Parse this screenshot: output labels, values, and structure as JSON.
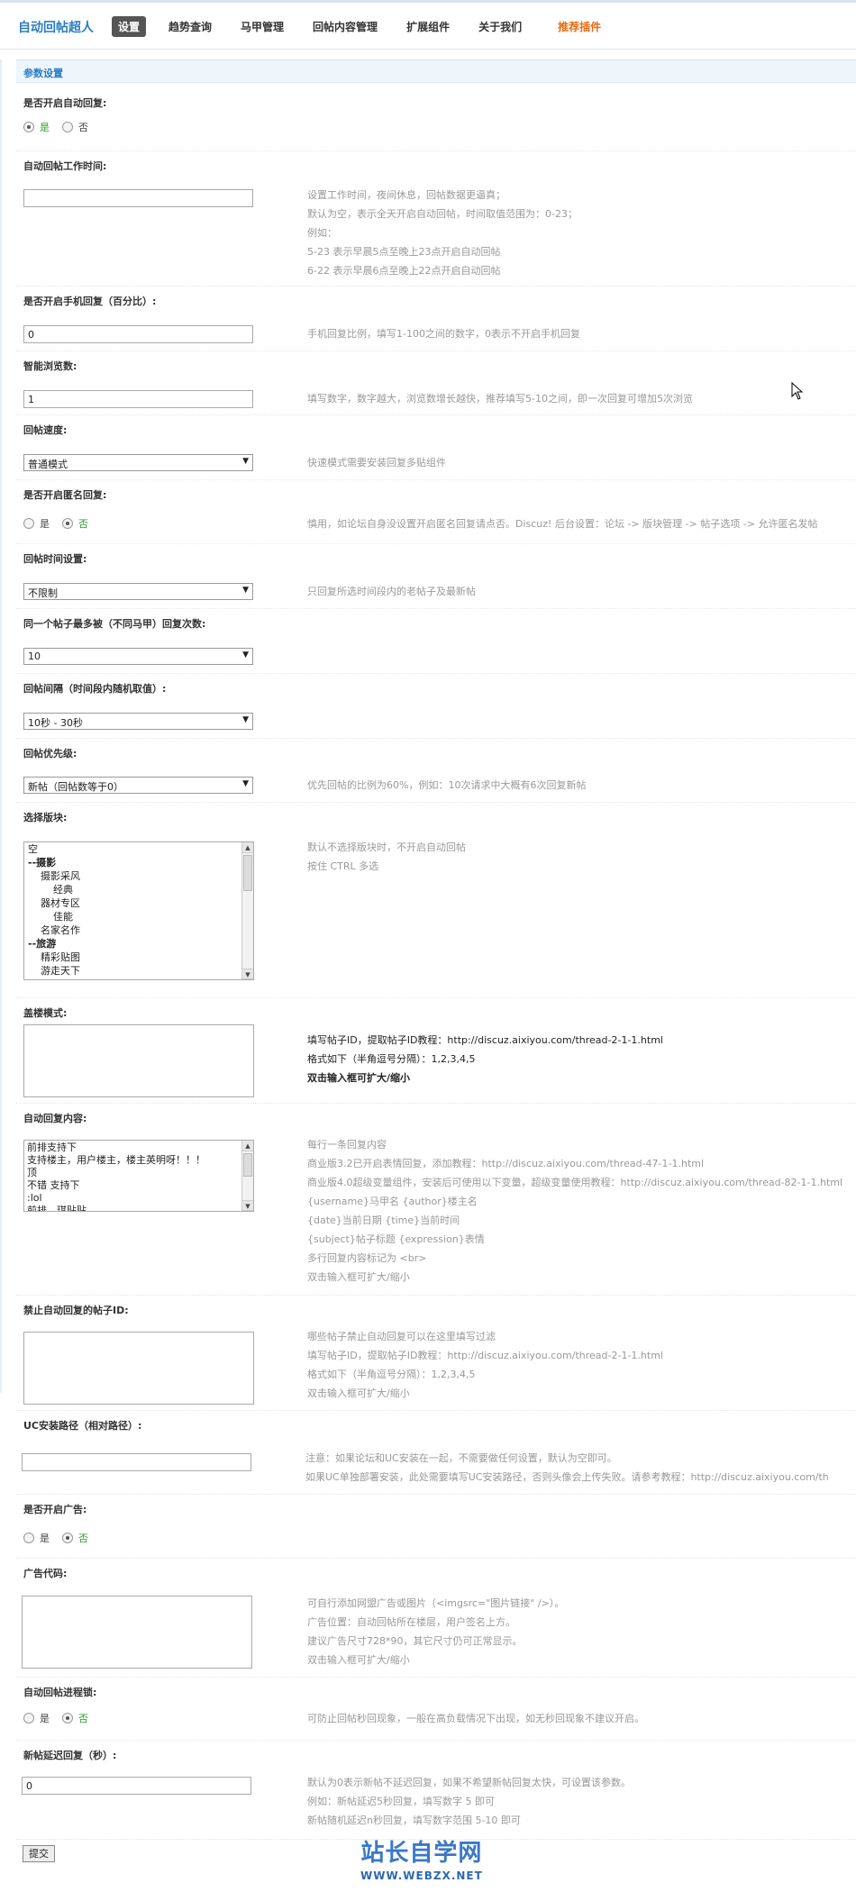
{
  "header": {
    "brand": "自动回帖超人",
    "nav": [
      "设置",
      "趋势查询",
      "马甲管理",
      "回帖内容管理",
      "扩展组件",
      "关于我们"
    ],
    "promo": "推荐插件"
  },
  "section_title": "参数设置",
  "rows": {
    "auto_reply": {
      "label": "是否开启自动回复:",
      "yes": "是",
      "no": "否",
      "selected": "是"
    },
    "work_time": {
      "label": "自动回帖工作时间:",
      "value": "",
      "help": [
        "设置工作时间，夜间休息，回帖数据更逼真；",
        "默认为空，表示全天开启自动回帖，时间取值范围为：0-23；",
        "例如：",
        "5-23 表示早晨5点至晚上23点开启自动回帖",
        "6-22 表示早晨6点至晚上22点开启自动回帖"
      ]
    },
    "mobile_reply": {
      "label": "是否开启手机回复（百分比）:",
      "value": "0",
      "help": "手机回复比例，填写1-100之间的数字，0表示不开启手机回复"
    },
    "browse_count": {
      "label": "智能浏览数:",
      "value": "1",
      "help": "填写数字，数字越大，浏览数增长越快，推荐填写5-10之间，即一次回复可增加5次浏览"
    },
    "reply_speed": {
      "label": "回帖速度:",
      "value": "普通模式",
      "help": "快速模式需要安装回复多贴组件"
    },
    "anonymous": {
      "label": "是否开启匿名回复:",
      "yes": "是",
      "no": "否",
      "selected": "否",
      "help": "慎用，如论坛自身没设置开启匿名回复请点否。Discuz! 后台设置：论坛 -> 版块管理 -> 帖子选项 -> 允许匿名发帖"
    },
    "reply_time": {
      "label": "回帖时间设置:",
      "value": "不限制",
      "help": "只回复所选时间段内的老帖子及最新帖"
    },
    "max_replies": {
      "label": "同一个帖子最多被（不同马甲）回复次数:",
      "value": "10"
    },
    "interval": {
      "label": "回帖间隔（时间段内随机取值）:",
      "value": "10秒 - 30秒"
    },
    "priority": {
      "label": "回帖优先级:",
      "value": "新帖（回帖数等于0）",
      "help": "优先回帖的比例为60%，例如：10次请求中大概有6次回复新帖"
    },
    "forums": {
      "label": "选择版块:",
      "options": [
        {
          "text": "空",
          "group": false
        },
        {
          "text": "--摄影",
          "group": true
        },
        {
          "text": "    摄影采风",
          "group": false
        },
        {
          "text": "        经典",
          "group": false
        },
        {
          "text": "    器材专区",
          "group": false
        },
        {
          "text": "        佳能",
          "group": false
        },
        {
          "text": "    名家名作",
          "group": false
        },
        {
          "text": "--旅游",
          "group": true
        },
        {
          "text": "    精彩贴图",
          "group": false
        },
        {
          "text": "    游走天下",
          "group": false
        }
      ],
      "help": [
        "默认不选择版块时，不开启自动回帖",
        "按住 CTRL 多选"
      ]
    },
    "floor_mode": {
      "label": "盖楼模式:",
      "value": "",
      "help": [
        "填写帖子ID，提取帖子ID教程：http://discuz.aixiyou.com/thread-2-1-1.html",
        "格式如下（半角逗号分隔）：1,2,3,4,5",
        "双击输入框可扩大/缩小"
      ]
    },
    "reply_content": {
      "label": "自动回复内容:",
      "value": "前排支持下\n支持楼主，用户楼主，楼主英明呀！！！\n顶\n不错 支持下\n:lol\n前排，琪贴贴",
      "help": [
        "每行一条回复内容",
        "商业版3.2已开启表情回复，添加教程：http://discuz.aixiyou.com/thread-47-1-1.html",
        "商业版4.0超级变量组件，安装后可使用以下变量，超级变量使用教程：http://discuz.aixiyou.com/thread-82-1-1.html",
        "{username}马甲名 {author}楼主名",
        "{date}当前日期 {time}当前时间",
        "{subject}帖子标题 {expression}表情",
        "多行回复内容标记为 <br>",
        "双击输入框可扩大/缩小"
      ]
    },
    "forbid_ids": {
      "label": "禁止自动回复的帖子ID:",
      "value": "",
      "help": [
        "哪些帖子禁止自动回复可以在这里填写过滤",
        "填写帖子ID，提取帖子ID教程：http://discuz.aixiyou.com/thread-2-1-1.html",
        "格式如下（半角逗号分隔）：1,2,3,4,5",
        "双击输入框可扩大/缩小"
      ]
    },
    "uc_path": {
      "label": "UC安装路径（相对路径）:",
      "value": "",
      "help": [
        "注意：如果论坛和UC安装在一起，不需要做任何设置，默认为空即可。",
        "如果UC单独部署安装，此处需要填写UC安装路径，否则头像会上传失败。请参考教程：http://discuz.aixiyou.com/th"
      ]
    },
    "ads_enabled": {
      "label": "是否开启广告:",
      "yes": "是",
      "no": "否",
      "selected": "否"
    },
    "ad_code": {
      "label": "广告代码:",
      "value": "",
      "help": [
        "可自行添加网盟广告或图片（<imgsrc=\"图片链接\" />）。",
        "广告位置：自动回帖所在楼层，用户签名上方。",
        "建议广告尺寸728*90，其它尺寸仍可正常显示。",
        "双击输入框可扩大/缩小"
      ]
    },
    "process_lock": {
      "label": "自动回帖进程锁:",
      "yes": "是",
      "no": "否",
      "selected": "否",
      "help": "可防止回帖秒回现象，一般在高负载情况下出现，如无秒回现象不建议开启。"
    },
    "delay": {
      "label": "新帖延迟回复（秒）:",
      "value": "0",
      "help": [
        "默认为0表示新帖不延迟回复，如果不希望新帖回复太快，可设置该参数。",
        "例如：新帖延迟5秒回复，填写数字 5 即可",
        "新帖随机延迟n秒回复，填写数字范围 5-10 即可"
      ]
    }
  },
  "submit_label": "提交",
  "watermark": {
    "title": "站长自学网",
    "url": "WWW.WEBZX.NET"
  },
  "colors": {
    "accent": "#2a7ec3",
    "promo": "#e86a10",
    "selected_radio": "#2aa32a"
  }
}
